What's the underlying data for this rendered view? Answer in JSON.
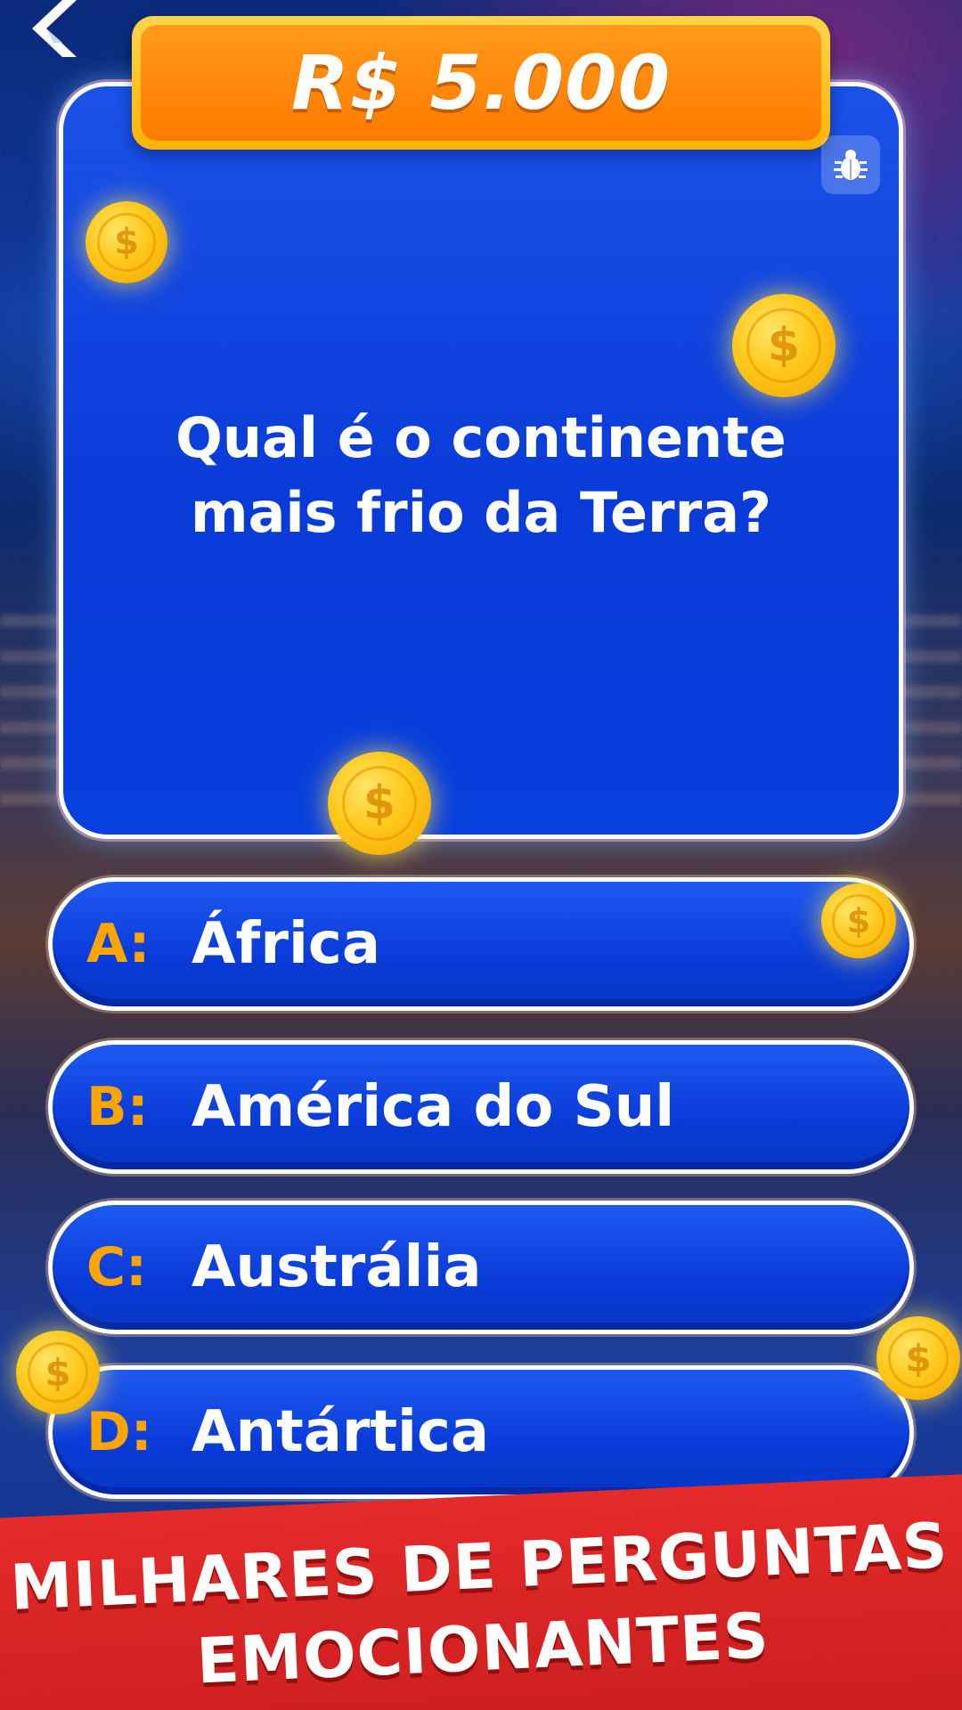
{
  "header": {
    "back_icon": "back-chevron-icon",
    "prize": "R$ 5.000",
    "bug_icon": "bug-icon"
  },
  "question": {
    "line1": "Qual é o continente",
    "line2": "mais frio da Terra?"
  },
  "answers": [
    {
      "letter": "A:",
      "text": "África"
    },
    {
      "letter": "B:",
      "text": "América do Sul"
    },
    {
      "letter": "C:",
      "text": "Austrália"
    },
    {
      "letter": "D:",
      "text": "Antártica"
    }
  ],
  "promo": {
    "line1": "MILHARES DE PERGUNTAS",
    "line2": "EMOCIONANTES"
  },
  "colors": {
    "card_blue": "#0a3bd8",
    "prize_orange": "#ff7a00",
    "letter_orange": "#ffa400",
    "promo_red": "#d42222",
    "coin_gold": "#ffc81a"
  }
}
